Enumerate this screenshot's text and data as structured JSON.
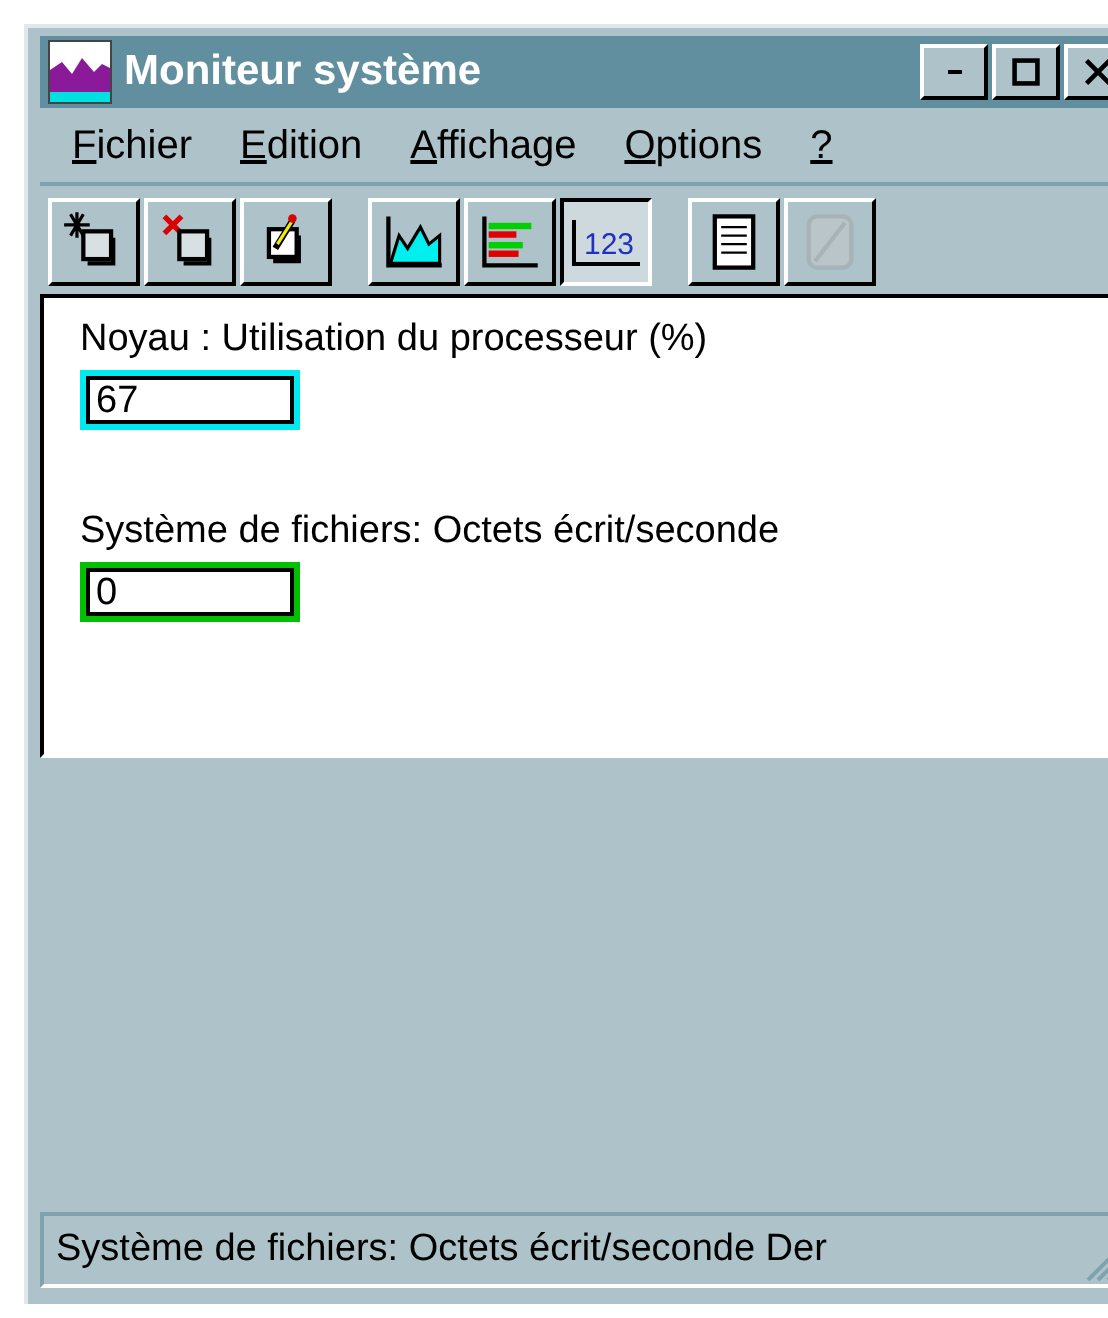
{
  "window": {
    "title": "Moniteur système"
  },
  "menu": [
    {
      "label": "Fichier"
    },
    {
      "label": "Edition"
    },
    {
      "label": "Affichage"
    },
    {
      "label": "Options"
    },
    {
      "label": "?"
    }
  ],
  "toolbar": [
    {
      "kind": "add",
      "selected": false,
      "disabled": false
    },
    {
      "kind": "delete",
      "selected": false,
      "disabled": false
    },
    {
      "kind": "edit",
      "selected": false,
      "disabled": false
    },
    {
      "kind": "chart",
      "selected": false,
      "disabled": false
    },
    {
      "kind": "histogram",
      "selected": false,
      "disabled": false
    },
    {
      "kind": "report",
      "label": "123",
      "selected": true,
      "disabled": false
    },
    {
      "kind": "log",
      "selected": false,
      "disabled": false
    },
    {
      "kind": "update",
      "selected": false,
      "disabled": true
    }
  ],
  "counters": [
    {
      "label": "Noyau : Utilisation du processeur (%)",
      "value": "67",
      "color": "#00e8f0"
    },
    {
      "label": "Système de fichiers: Octets écrit/seconde",
      "value": "0",
      "color": "#00c000"
    }
  ],
  "status_bar": "Système de fichiers: Octets écrit/seconde  Der"
}
